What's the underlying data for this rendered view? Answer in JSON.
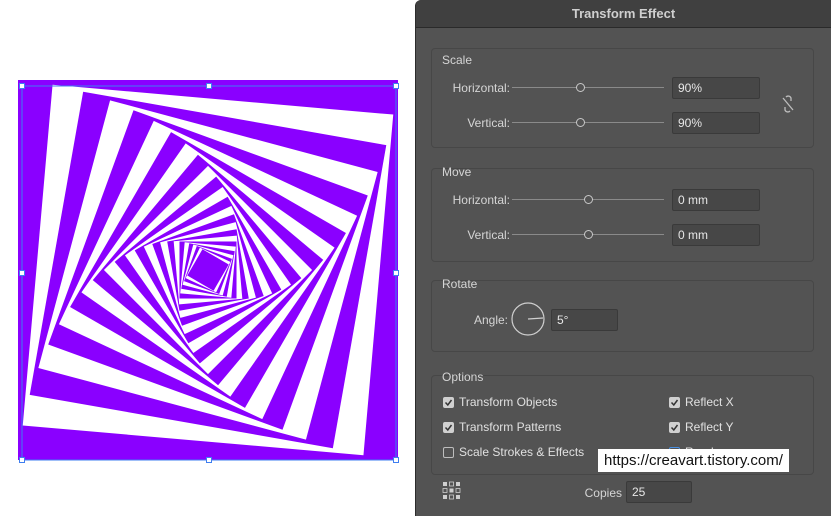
{
  "dialog": {
    "title": "Transform Effect",
    "scale": {
      "title": "Scale",
      "horizontal_label": "Horizontal:",
      "horizontal_value": "90%",
      "vertical_label": "Vertical:",
      "vertical_value": "90%"
    },
    "move": {
      "title": "Move",
      "horizontal_label": "Horizontal:",
      "horizontal_value": "0 mm",
      "vertical_label": "Vertical:",
      "vertical_value": "0 mm"
    },
    "rotate": {
      "title": "Rotate",
      "angle_label": "Angle:",
      "angle_value": "5°"
    },
    "options": {
      "title": "Options",
      "transform_objects": "Transform Objects",
      "transform_patterns": "Transform Patterns",
      "scale_strokes": "Scale Strokes & Effects",
      "reflect_x": "Reflect X",
      "reflect_y": "Reflect Y",
      "random": "Random"
    },
    "copies_label": "Copies",
    "copies_value": "25"
  },
  "watermark": "https://creavart.tistory.com/",
  "colors": {
    "art_purple": "#8a00ff",
    "panel_bg": "#535353"
  }
}
